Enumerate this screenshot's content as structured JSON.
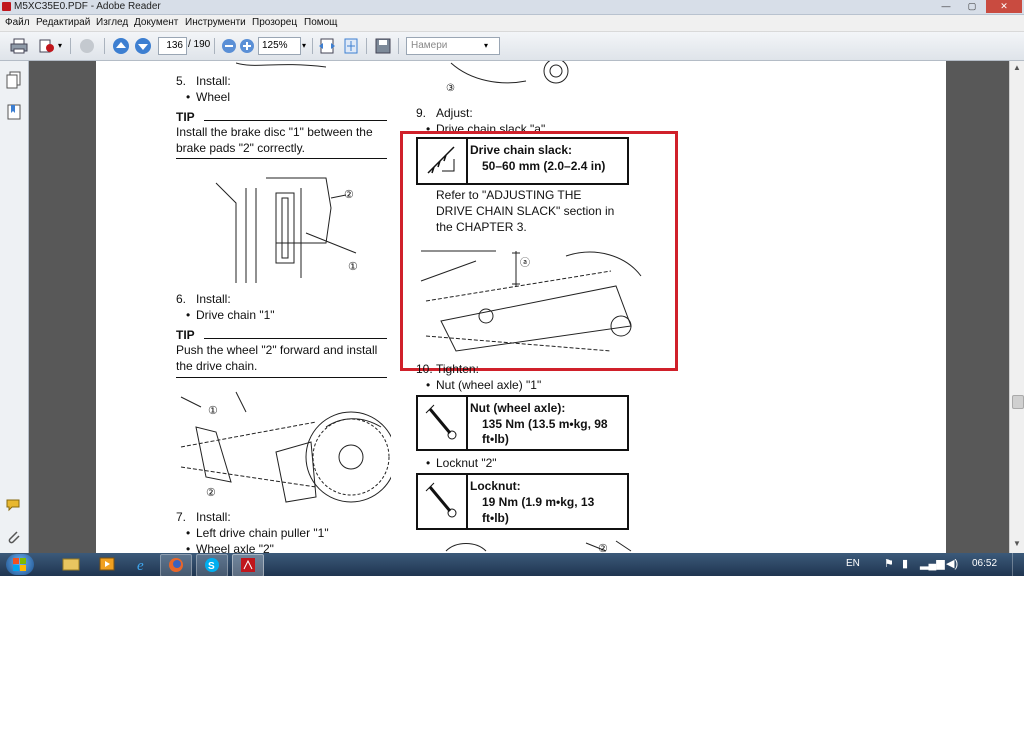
{
  "window": {
    "title": "M5XC35E0.PDF - Adobe Reader"
  },
  "menu": [
    "Файл",
    "Редактирай",
    "Изглед",
    "Документ",
    "Инструменти",
    "Прозорец",
    "Помощ"
  ],
  "toolbar": {
    "page_current": "136",
    "page_total": "/ 190",
    "zoom": "125%",
    "find_placeholder": "Намери"
  },
  "doc": {
    "step5": {
      "num": "5.",
      "label": "Install:",
      "item": "Wheel"
    },
    "tip1": {
      "label": "TIP",
      "text_l1": "Install the brake disc \"1\" between the",
      "text_l2": "brake pads \"2\" correctly."
    },
    "step6": {
      "num": "6.",
      "label": "Install:",
      "item": "Drive chain \"1\""
    },
    "tip2": {
      "label": "TIP",
      "text_l1": "Push the wheel \"2\" forward and install",
      "text_l2": "the drive chain."
    },
    "step7": {
      "num": "7.",
      "label": "Install:",
      "item1": "Left drive chain puller \"1\"",
      "item2": "Wheel axle \"2\""
    },
    "step9": {
      "num": "9.",
      "label": "Adjust:",
      "item": "Drive chain slack \"a\""
    },
    "spec_slack": {
      "title": "Drive chain slack:",
      "value": "50–60 mm (2.0–2.4 in)"
    },
    "refer": {
      "l1": "Refer to \"ADJUSTING THE",
      "l2": "DRIVE CHAIN SLACK\" section in",
      "l3": "the CHAPTER 3."
    },
    "step10": {
      "num": "10.",
      "label": "Tighten:",
      "item1": "Nut (wheel axle) \"1\"",
      "item2": "Locknut \"2\""
    },
    "spec_nut": {
      "title": "Nut (wheel axle):",
      "l1": "135 Nm (13.5 m•kg, 98",
      "l2": "ft•lb)"
    },
    "spec_lock": {
      "title": "Locknut:",
      "l1": "19 Nm (1.9 m•kg, 13",
      "l2": "ft•lb)"
    },
    "callouts": {
      "c1": "①",
      "c2": "②",
      "c3": "③",
      "ca": "ⓐ"
    }
  },
  "taskbar": {
    "lang": "EN",
    "time": "06:52"
  },
  "colors": {
    "highlight": "#d0202a",
    "doc_bg": "#585858"
  }
}
